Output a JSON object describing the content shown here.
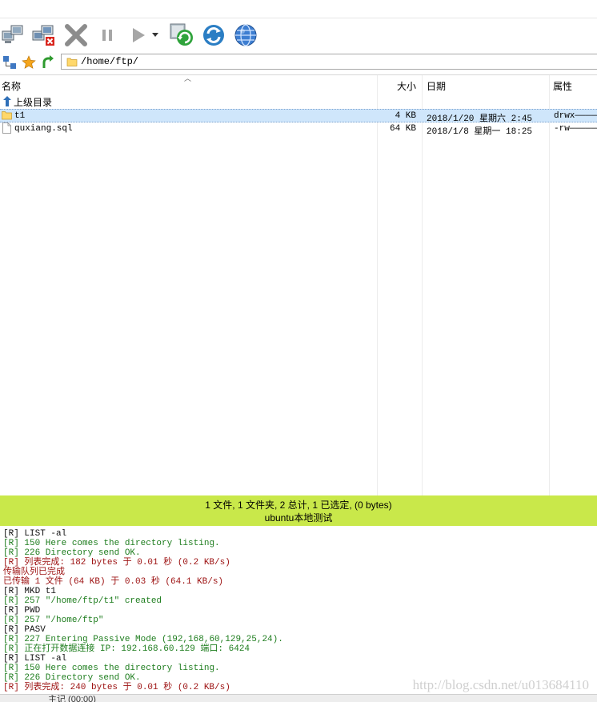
{
  "toolbar": {
    "buttons": [
      {
        "name": "connect-icon"
      },
      {
        "name": "disconnect-icon"
      },
      {
        "name": "cancel-icon"
      },
      {
        "name": "pause-icon"
      },
      {
        "name": "play-icon"
      },
      {
        "name": "play-dropdown-icon"
      },
      {
        "name": "refresh-transfer-icon"
      },
      {
        "name": "refresh-icon"
      },
      {
        "name": "globe-icon"
      }
    ]
  },
  "pathbar": {
    "path": "/home/ftp/"
  },
  "filelist": {
    "columns": {
      "name": "名称",
      "size": "大小",
      "date": "日期",
      "attr": "属性"
    },
    "parent_dir": "上级目录",
    "rows": [
      {
        "name": "t1",
        "size": "4 KB",
        "date": "2018/1/20 星期六 2:45",
        "attr": "drwx—————",
        "type": "folder",
        "selected": true
      },
      {
        "name": "quxiang.sql",
        "size": "64 KB",
        "date": "2018/1/8 星期一 18:25",
        "attr": "-rw———————",
        "type": "file",
        "selected": false
      }
    ]
  },
  "status": {
    "summary": "1 文件, 1 文件夹, 2 总计, 1 已选定, (0 bytes)",
    "site": "ubuntu本地测试"
  },
  "log": [
    {
      "text": "[R] LIST -al",
      "color": "black"
    },
    {
      "text": "[R] 150 Here comes the directory listing.",
      "color": "green"
    },
    {
      "text": "[R] 226 Directory send OK.",
      "color": "green"
    },
    {
      "text": "[R] 列表完成: 182 bytes 于 0.01 秒 (0.2 KB/s)",
      "color": "red"
    },
    {
      "text": "传输队列已完成",
      "color": "red"
    },
    {
      "text": "已传输 1 文件 (64 KB) 于 0.03 秒 (64.1 KB/s)",
      "color": "red"
    },
    {
      "text": "[R] MKD t1",
      "color": "black"
    },
    {
      "text": "[R] 257 \"/home/ftp/t1\" created",
      "color": "green"
    },
    {
      "text": "[R] PWD",
      "color": "black"
    },
    {
      "text": "[R] 257 \"/home/ftp\"",
      "color": "green"
    },
    {
      "text": "[R] PASV",
      "color": "black"
    },
    {
      "text": "[R] 227 Entering Passive Mode (192,168,60,129,25,24).",
      "color": "green"
    },
    {
      "text": "[R] 正在打开数据连接 IP: 192.168.60.129 端口: 6424",
      "color": "green"
    },
    {
      "text": "[R] LIST -al",
      "color": "black"
    },
    {
      "text": "[R] 150 Here comes the directory listing.",
      "color": "green"
    },
    {
      "text": "[R] 226 Directory send OK.",
      "color": "green"
    },
    {
      "text": "[R] 列表完成: 240 bytes 于 0.01 秒 (0.2 KB/s)",
      "color": "red"
    }
  ],
  "watermark": "http://blog.csdn.net/u013684110",
  "bottom_strip": "主记 (00:00)",
  "colors": {
    "status_bar_bg": "#c9e84a",
    "selected_row_bg": "#cfe6fb",
    "log_green": "#1e7d1e",
    "log_red": "#9c1010"
  }
}
